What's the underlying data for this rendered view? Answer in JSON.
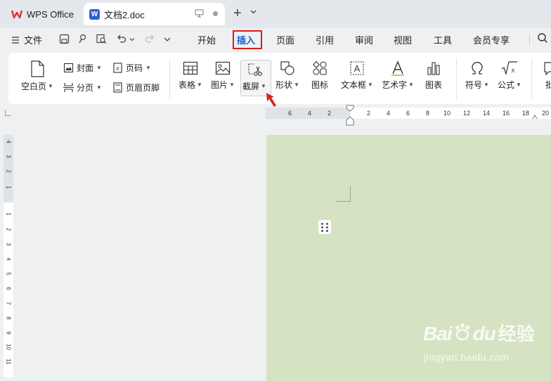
{
  "titlebar": {
    "home_tab": "WPS Office",
    "doc_tab": "文档2.doc",
    "doc_badge": "W",
    "new_tab": "+"
  },
  "menubar": {
    "file": "文件",
    "tabs": [
      "开始",
      "插入",
      "页面",
      "引用",
      "审阅",
      "视图",
      "工具",
      "会员专享"
    ],
    "active_tab": "插入"
  },
  "ribbon": {
    "blank_page": "空白页",
    "cover": "封面",
    "page_break": "分页",
    "page_number": "页码",
    "header_footer": "页眉页脚",
    "table": "表格",
    "picture": "图片",
    "screenshot": "截屏",
    "shape": "形状",
    "icon": "图标",
    "textbox": "文本框",
    "wordart": "艺术字",
    "chart": "图表",
    "symbol": "符号",
    "formula": "公式",
    "cut": "批"
  },
  "ruler": {
    "h_labels": [
      "6",
      "4",
      "2",
      "2",
      "4",
      "6",
      "8",
      "10",
      "12",
      "14",
      "16",
      "18",
      "20"
    ],
    "v_labels": [
      "4",
      "3",
      "2",
      "1",
      "1",
      "2",
      "3",
      "4",
      "5",
      "6",
      "7",
      "8",
      "9",
      "10",
      "11"
    ]
  },
  "watermark": {
    "logo": "Bai",
    "logo2": "du",
    "cn": "经验",
    "url": "jingyan.baidu.com"
  },
  "colors": {
    "accent": "#1a5fd6",
    "highlight_box": "#d81e1e",
    "page_bg": "#d6e3c2",
    "wps_red": "#e0312f"
  }
}
